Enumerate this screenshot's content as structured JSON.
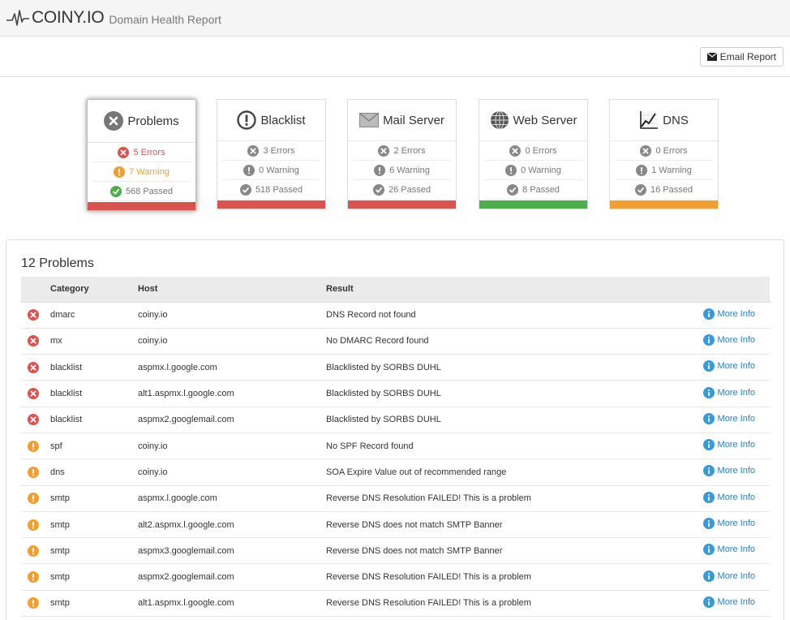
{
  "header": {
    "brand": "COINY.IO",
    "subtitle": "Domain Health Report"
  },
  "toolbar": {
    "email_label": "Email Report"
  },
  "colors": {
    "error": "#d9534f",
    "warning": "#f0a030",
    "passed": "#4cae4c",
    "neutral": "#888888",
    "link": "#2a80c8"
  },
  "cards": [
    {
      "title": "Problems",
      "icon": "x-circle-icon",
      "errors": "5 Errors",
      "warnings": "7 Warning",
      "passed": "568 Passed",
      "status": "error",
      "active": true
    },
    {
      "title": "Blacklist",
      "icon": "exclamation-circle-icon",
      "errors": "3 Errors",
      "warnings": "0 Warning",
      "passed": "518 Passed",
      "status": "error",
      "active": false
    },
    {
      "title": "Mail Server",
      "icon": "envelope-icon",
      "errors": "2 Errors",
      "warnings": "6 Warning",
      "passed": "26 Passed",
      "status": "error",
      "active": false
    },
    {
      "title": "Web Server",
      "icon": "globe-icon",
      "errors": "0 Errors",
      "warnings": "0 Warning",
      "passed": "8 Passed",
      "status": "passed",
      "active": false
    },
    {
      "title": "DNS",
      "icon": "chart-icon",
      "errors": "0 Errors",
      "warnings": "1 Warning",
      "passed": "16 Passed",
      "status": "warning",
      "active": false
    }
  ],
  "problems": {
    "title": "12 Problems",
    "columns": {
      "category": "Category",
      "host": "Host",
      "result": "Result"
    },
    "more_label": "More Info",
    "rows": [
      {
        "level": "error",
        "category": "dmarc",
        "host": "coiny.io",
        "result": "DNS Record not found"
      },
      {
        "level": "error",
        "category": "mx",
        "host": "coiny.io",
        "result": "No DMARC Record found"
      },
      {
        "level": "error",
        "category": "blacklist",
        "host": "aspmx.l.google.com",
        "result": "Blacklisted by SORBS DUHL"
      },
      {
        "level": "error",
        "category": "blacklist",
        "host": "alt1.aspmx.l.google.com",
        "result": "Blacklisted by SORBS DUHL"
      },
      {
        "level": "error",
        "category": "blacklist",
        "host": "aspmx2.googlemail.com",
        "result": "Blacklisted by SORBS DUHL"
      },
      {
        "level": "warning",
        "category": "spf",
        "host": "coiny.io",
        "result": "No SPF Record found"
      },
      {
        "level": "warning",
        "category": "dns",
        "host": "coiny.io",
        "result": "SOA Expire Value out of recommended range"
      },
      {
        "level": "warning",
        "category": "smtp",
        "host": "aspmx.l.google.com",
        "result": "Reverse DNS Resolution FAILED! This is a problem"
      },
      {
        "level": "warning",
        "category": "smtp",
        "host": "alt2.aspmx.l.google.com",
        "result": "Reverse DNS does not match SMTP Banner"
      },
      {
        "level": "warning",
        "category": "smtp",
        "host": "aspmx3.googlemail.com",
        "result": "Reverse DNS does not match SMTP Banner"
      },
      {
        "level": "warning",
        "category": "smtp",
        "host": "aspmx2.googlemail.com",
        "result": "Reverse DNS Resolution FAILED! This is a problem"
      },
      {
        "level": "warning",
        "category": "smtp",
        "host": "alt1.aspmx.l.google.com",
        "result": "Reverse DNS Resolution FAILED! This is a problem"
      }
    ]
  }
}
